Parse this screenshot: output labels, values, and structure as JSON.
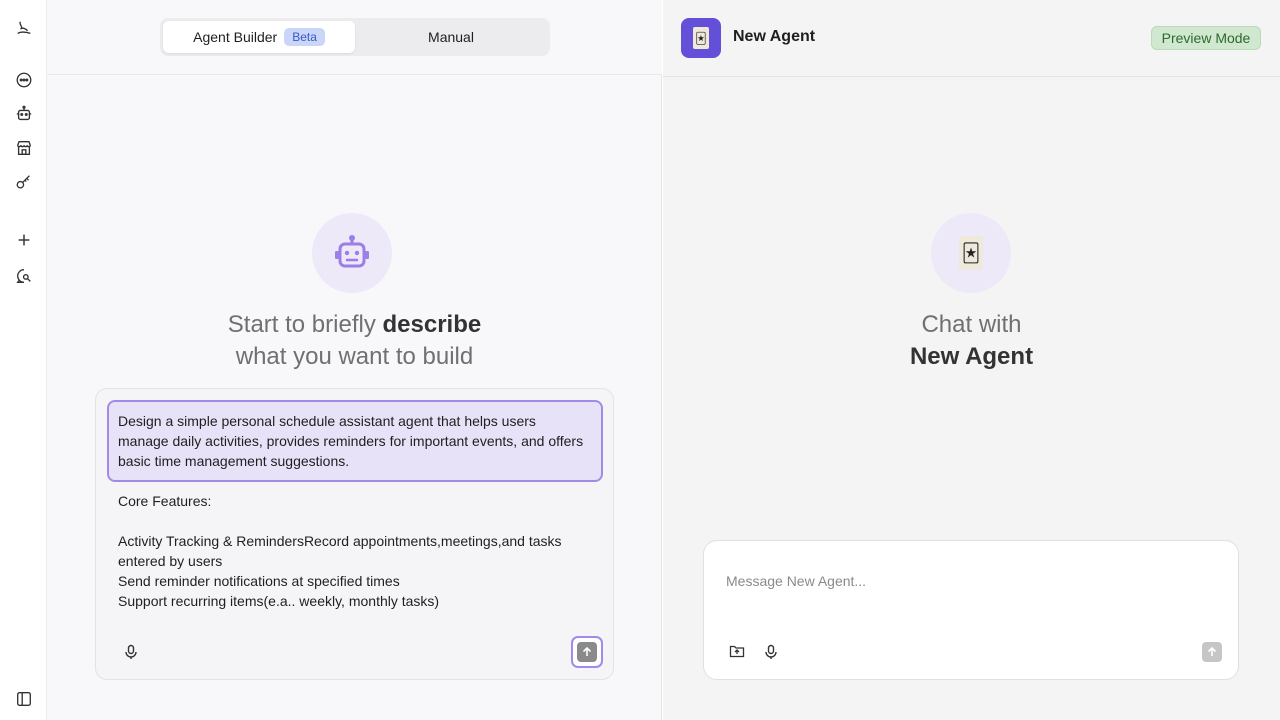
{
  "sidebar": {
    "icons": [
      "logo-icon",
      "chat-icon",
      "agent-icon",
      "store-icon",
      "key-icon",
      "plus-icon",
      "search-chat-icon",
      "panel-toggle-icon"
    ]
  },
  "builder": {
    "tabs": [
      {
        "label": "Agent Builder",
        "badge": "Beta",
        "active": true
      },
      {
        "label": "Manual",
        "active": false
      }
    ],
    "hero": {
      "line1_prefix": "Start to briefly ",
      "line1_bold": "describe",
      "line2": "what you want to build"
    },
    "prompt": {
      "highlighted": "Design a simple personal schedule assistant agent that helps users manage daily activities, provides reminders for important events, and offers basic time management suggestions.",
      "heading": "Core Features:",
      "line1": "Activity Tracking & RemindersRecord appointments,meetings,and tasks entered by users",
      "line2": "Send reminder notifications at specified times",
      "line3": "Support recurring items(e.a.. weekly, monthly tasks)"
    }
  },
  "preview": {
    "agent_name": "New Agent",
    "mode_badge": "Preview Mode",
    "hero_line1": "Chat with",
    "hero_line2": "New Agent",
    "message_placeholder": "Message New Agent..."
  },
  "colors": {
    "accent": "#a28ae8",
    "avatar_bg": "#6450d8",
    "badge_bg": "#c9d6f7",
    "preview_badge_bg": "#cfe8cf"
  }
}
